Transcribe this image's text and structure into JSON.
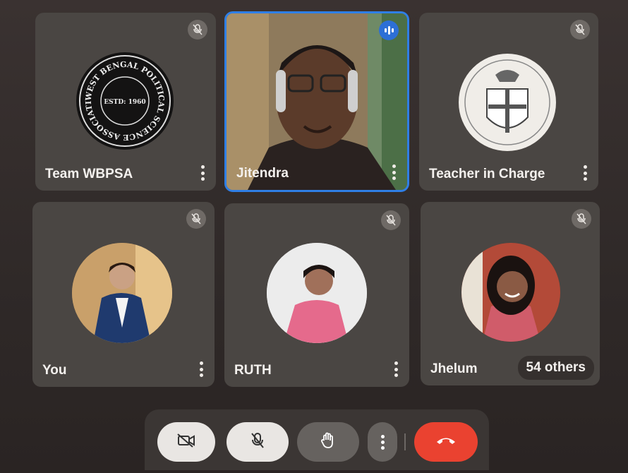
{
  "participants": [
    {
      "name": "Team WBPSA",
      "muted": true,
      "avatar_icon": "wbpsa-seal-logo",
      "logo": {
        "top": "WEST BENGAL POLITICAL SCIENCE ASSOCIATION",
        "center": "ESTD: 1960"
      }
    },
    {
      "name": "Jitendra",
      "muted": false,
      "speaking": true,
      "avatar_icon": "camera-video-feed"
    },
    {
      "name": "Teacher in Charge",
      "muted": true,
      "avatar_icon": "college-crest-logo"
    },
    {
      "name": "You",
      "muted": true,
      "avatar_icon": "profile-photo"
    },
    {
      "name": "RUTH",
      "muted": true,
      "avatar_icon": "profile-photo"
    },
    {
      "name": "Jhelum",
      "muted": true,
      "avatar_icon": "profile-photo"
    }
  ],
  "others_label": "54 others",
  "toolbar": {
    "camera_icon": "camera-off-icon",
    "mic_icon": "mic-off-icon",
    "hand_icon": "raise-hand-icon",
    "more_icon": "more-options-icon",
    "end_icon": "end-call-icon"
  },
  "colors": {
    "active_border": "#2f7fe6",
    "end_call": "#ea4230",
    "tile": "#4a4643"
  }
}
